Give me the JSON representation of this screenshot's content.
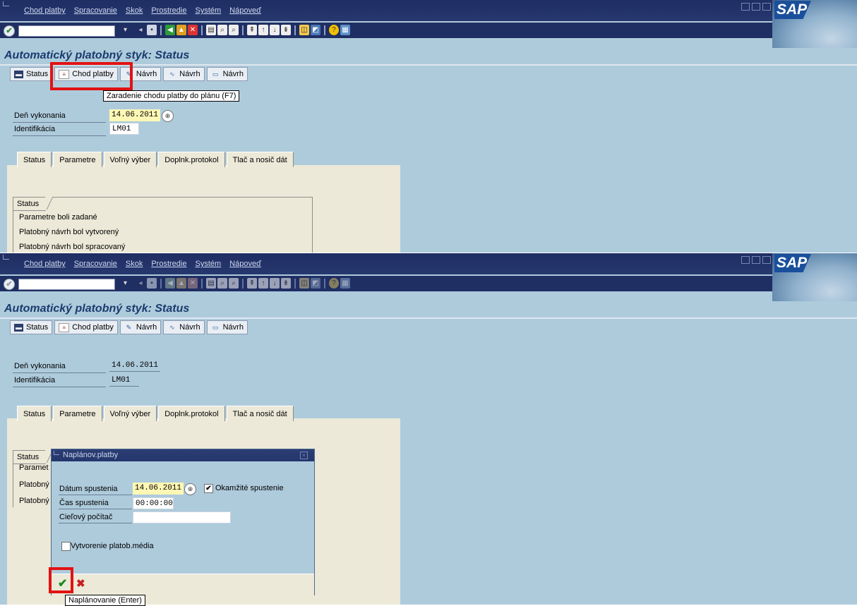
{
  "menu": [
    "Chod platby",
    "Spracovanie",
    "Skok",
    "Prostredie",
    "Systém",
    "Nápoveď"
  ],
  "logo": "SAP",
  "screen_title": "Automatický platobný styk: Status",
  "app_toolbar": [
    "Status",
    "Chod platby",
    "Návrh",
    "Návrh",
    "Návrh"
  ],
  "tooltip_top": "Zaradenie chodu platby do plánu  (F7)",
  "fields": {
    "run_date_label": "Deň vykonania",
    "run_date": "14.06.2011",
    "id_label": "Identifikácia",
    "id": "LM01"
  },
  "tabs": [
    "Status",
    "Parametre",
    "Voľný výber",
    "Doplnk.protokol",
    "Tlač a nosič dát"
  ],
  "status_group": {
    "title": "Status",
    "lines": [
      "Parametre boli zadané",
      "Platobný návrh bol vytvorený",
      "Platobný návrh bol spracovaný"
    ],
    "truncated": [
      "Paramet",
      "Platobný",
      "Platobný"
    ]
  },
  "dialog": {
    "title": "Naplánov.platby",
    "start_date_label": "Dátum spustenia",
    "start_date": "14.06.2011",
    "immediate_label": "Okamžité spustenie",
    "immediate_checked": true,
    "start_time_label": "Čas spustenia",
    "start_time": "00:00:00",
    "target_label": "Cieľový počítač",
    "target": "",
    "media_label": "Vytvorenie platob.média",
    "media_checked": false,
    "tooltip": "Naplánovanie  (Enter)"
  },
  "colors": {
    "background": "#aecbdc",
    "title_bar": "#1f2e63",
    "highlight": "#e21212"
  }
}
